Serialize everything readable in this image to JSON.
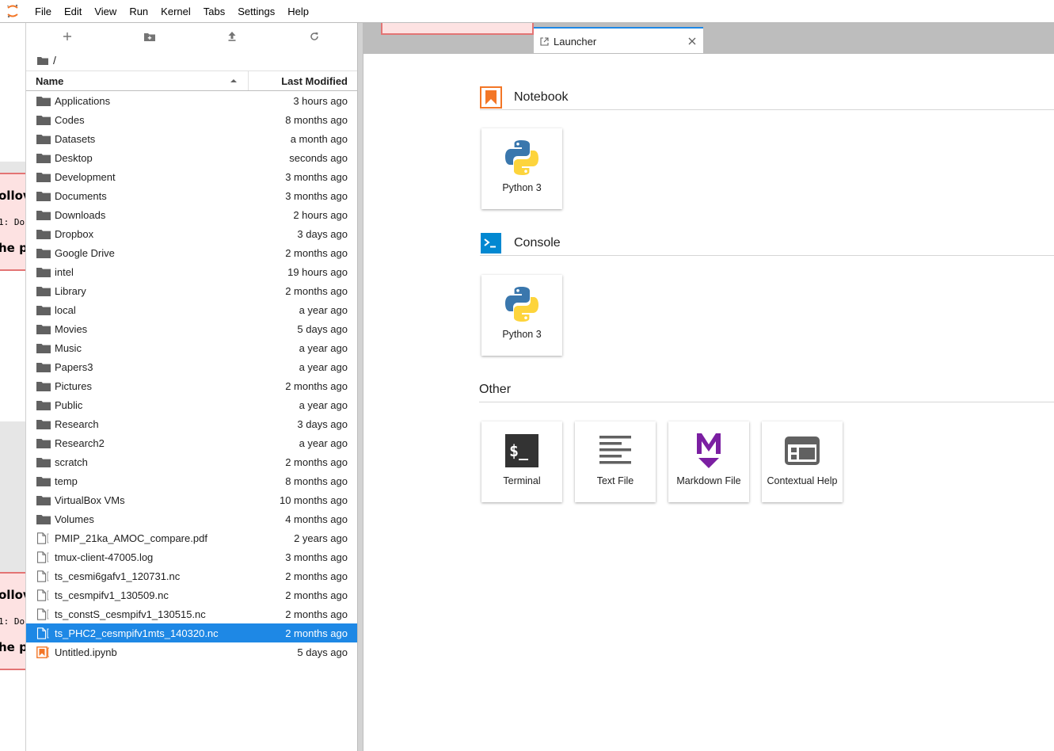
{
  "menubar": {
    "items": [
      "File",
      "Edit",
      "View",
      "Run",
      "Kernel",
      "Tabs",
      "Settings",
      "Help"
    ]
  },
  "filebrowser": {
    "breadcrumb": "/",
    "columns": {
      "name": "Name",
      "modified": "Last Modified"
    },
    "files": [
      {
        "name": "Applications",
        "modified": "3 hours ago",
        "type": "folder"
      },
      {
        "name": "Codes",
        "modified": "8 months ago",
        "type": "folder"
      },
      {
        "name": "Datasets",
        "modified": "a month ago",
        "type": "folder"
      },
      {
        "name": "Desktop",
        "modified": "seconds ago",
        "type": "folder"
      },
      {
        "name": "Development",
        "modified": "3 months ago",
        "type": "folder"
      },
      {
        "name": "Documents",
        "modified": "3 months ago",
        "type": "folder"
      },
      {
        "name": "Downloads",
        "modified": "2 hours ago",
        "type": "folder"
      },
      {
        "name": "Dropbox",
        "modified": "3 days ago",
        "type": "folder"
      },
      {
        "name": "Google Drive",
        "modified": "2 months ago",
        "type": "folder"
      },
      {
        "name": "intel",
        "modified": "19 hours ago",
        "type": "folder"
      },
      {
        "name": "Library",
        "modified": "2 months ago",
        "type": "folder"
      },
      {
        "name": "local",
        "modified": "a year ago",
        "type": "folder"
      },
      {
        "name": "Movies",
        "modified": "5 days ago",
        "type": "folder"
      },
      {
        "name": "Music",
        "modified": "a year ago",
        "type": "folder"
      },
      {
        "name": "Papers3",
        "modified": "a year ago",
        "type": "folder"
      },
      {
        "name": "Pictures",
        "modified": "2 months ago",
        "type": "folder"
      },
      {
        "name": "Public",
        "modified": "a year ago",
        "type": "folder"
      },
      {
        "name": "Research",
        "modified": "3 days ago",
        "type": "folder"
      },
      {
        "name": "Research2",
        "modified": "a year ago",
        "type": "folder"
      },
      {
        "name": "scratch",
        "modified": "2 months ago",
        "type": "folder"
      },
      {
        "name": "temp",
        "modified": "8 months ago",
        "type": "folder"
      },
      {
        "name": "VirtualBox VMs",
        "modified": "10 months ago",
        "type": "folder"
      },
      {
        "name": "Volumes",
        "modified": "4 months ago",
        "type": "folder"
      },
      {
        "name": "PMIP_21ka_AMOC_compare.pdf",
        "modified": "2 years ago",
        "type": "file"
      },
      {
        "name": "tmux-client-47005.log",
        "modified": "3 months ago",
        "type": "file"
      },
      {
        "name": "ts_cesmi6gafv1_120731.nc",
        "modified": "2 months ago",
        "type": "file"
      },
      {
        "name": "ts_cesmpifv1_130509.nc",
        "modified": "2 months ago",
        "type": "file"
      },
      {
        "name": "ts_constS_cesmpifv1_130515.nc",
        "modified": "2 months ago",
        "type": "file"
      },
      {
        "name": "ts_PHC2_cesmpifv1mts_140320.nc",
        "modified": "2 months ago",
        "type": "file",
        "selected": true
      },
      {
        "name": "Untitled.ipynb",
        "modified": "5 days ago",
        "type": "notebook"
      }
    ]
  },
  "left_strip": {
    "cell_heading": "ollov",
    "cell_code": "1: Do",
    "cell_text": "he p"
  },
  "tabs": {
    "active_label": "Launcher"
  },
  "launcher": {
    "notebook": {
      "title": "Notebook",
      "cards": [
        "Python 3"
      ]
    },
    "console": {
      "title": "Console",
      "cards": [
        "Python 3"
      ]
    },
    "other": {
      "title": "Other",
      "cards": [
        "Terminal",
        "Text File",
        "Markdown File",
        "Contextual Help"
      ]
    }
  },
  "colors": {
    "accent": "#1e88e5",
    "notebook_orange": "#f37626",
    "console_blue": "#0288d1",
    "markdown_purple": "#7b1fa2",
    "terminal_dark": "#333333"
  }
}
